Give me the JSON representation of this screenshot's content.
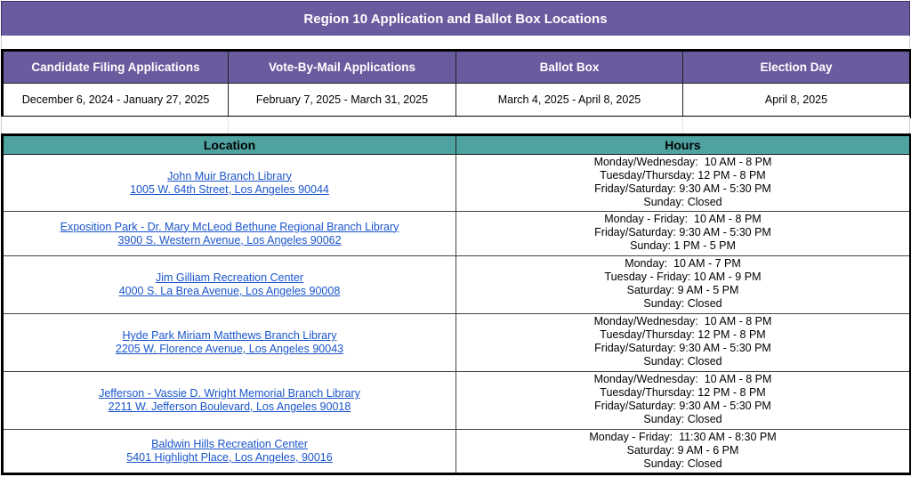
{
  "title": "Region 10 Application and Ballot Box Locations",
  "colors": {
    "header_purple": "#6a5a9e",
    "header_teal": "#4ea3a0",
    "link_blue": "#1a55cc"
  },
  "dates_table": {
    "headers": [
      "Candidate Filing Applications",
      "Vote-By-Mail Applications",
      "Ballot Box",
      "Election Day"
    ],
    "values": [
      "December 6, 2024 - January 27, 2025",
      "February 7, 2025 - March 31, 2025",
      "March 4, 2025 - April 8, 2025",
      "April 8, 2025"
    ]
  },
  "locations_table": {
    "headers": [
      "Location",
      "Hours"
    ],
    "rows": [
      {
        "name": "John Muir Branch Library",
        "address": "1005 W. 64th Street, Los Angeles 90044",
        "hours": [
          "Monday/Wednesday:  10 AM - 8 PM",
          "Tuesday/Thursday: 12 PM - 8 PM",
          "Friday/Saturday: 9:30 AM - 5:30 PM",
          "Sunday: Closed"
        ]
      },
      {
        "name": "Exposition Park - Dr. Mary McLeod Bethune Regional Branch Library",
        "address": "3900 S. Western Avenue, Los Angeles 90062",
        "hours": [
          "Monday - Friday:  10 AM - 8 PM",
          "Friday/Saturday: 9:30 AM - 5:30 PM",
          "Sunday: 1 PM - 5 PM"
        ]
      },
      {
        "name": "Jim Gilliam Recreation Center",
        "address": "4000 S. La Brea Avenue, Los Angeles 90008",
        "hours": [
          "Monday:  10 AM - 7 PM",
          "Tuesday - Friday: 10 AM - 9 PM",
          "Saturday: 9 AM - 5 PM",
          "Sunday: Closed"
        ]
      },
      {
        "name": "Hyde Park Miriam Matthews Branch Library",
        "address": "2205 W. Florence Avenue, Los Angeles 90043",
        "hours": [
          "Monday/Wednesday:  10 AM - 8 PM",
          "Tuesday/Thursday: 12 PM - 8 PM",
          "Friday/Saturday: 9:30 AM - 5:30 PM",
          "Sunday: Closed"
        ]
      },
      {
        "name": "Jefferson - Vassie D. Wright Memorial Branch Library",
        "address": "2211 W. Jefferson Boulevard, Los Angeles 90018",
        "hours": [
          "Monday/Wednesday:  10 AM - 8 PM",
          "Tuesday/Thursday: 12 PM - 8 PM",
          "Friday/Saturday: 9:30 AM - 5:30 PM",
          "Sunday: Closed"
        ]
      },
      {
        "name": "Baldwin Hills Recreation Center",
        "address": "5401 Highlight Place, Los Angeles, 90016",
        "hours": [
          "Monday - Friday:  11:30 AM - 8:30 PM",
          "Saturday: 9 AM - 6 PM",
          "Sunday: Closed"
        ]
      }
    ]
  }
}
